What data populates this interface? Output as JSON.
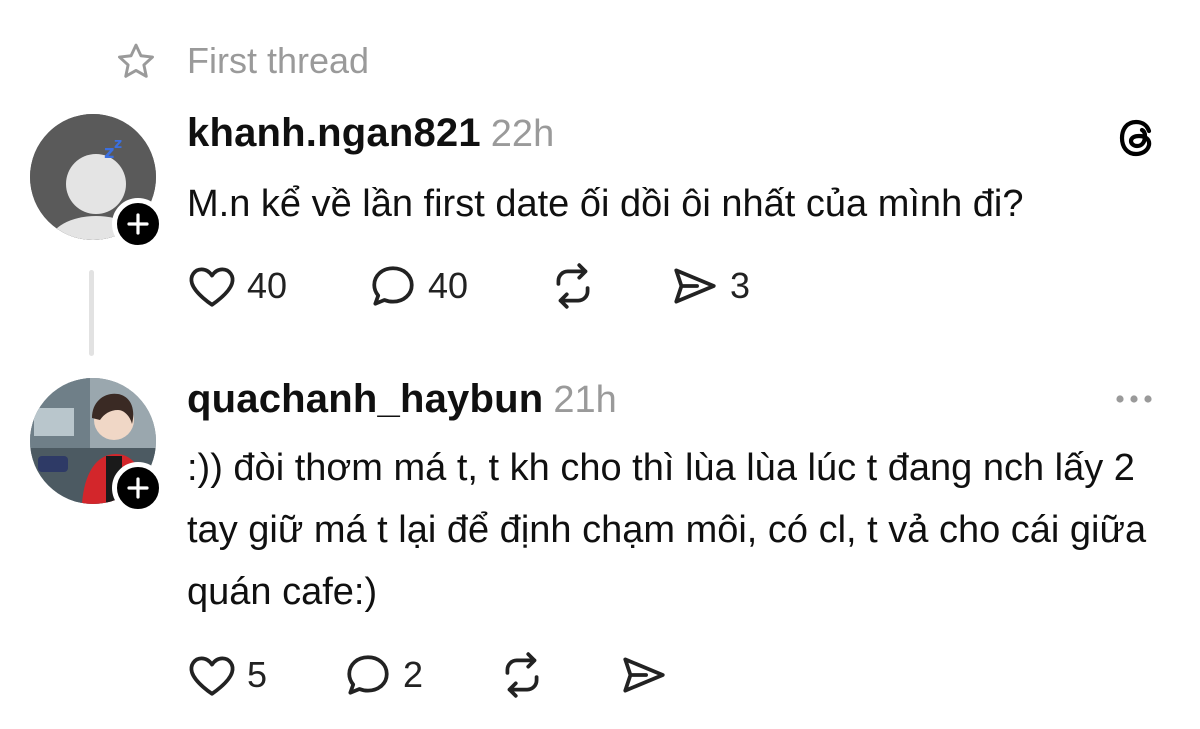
{
  "header": {
    "label": "First thread",
    "icon": "star-icon"
  },
  "posts": [
    {
      "username": "khanh.ngan821",
      "time": "22h",
      "text": "M.n kể về lần first date ối dồi ôi nhất của mình đi?",
      "likes": "40",
      "replies": "40",
      "shares": "3"
    },
    {
      "username": "quachanh_haybun",
      "time": "21h",
      "text": ":)) đòi thơm má t, t kh cho thì lùa lùa lúc t đang nch lấy 2 tay giữ má t lại để định chạm môi, có cl, t vả cho cái giữa quán cafe:)",
      "likes": "5",
      "replies": "2"
    }
  ],
  "colors": {
    "text": "#101010",
    "muted": "#9a9a9a",
    "badge": "#000000",
    "line": "#e2e2e2"
  }
}
